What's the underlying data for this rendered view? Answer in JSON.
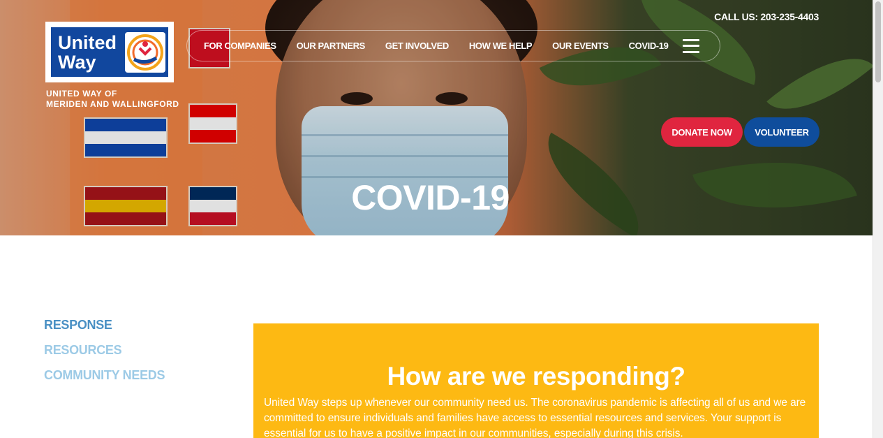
{
  "header": {
    "logo": {
      "line1": "United",
      "line2": "Way",
      "mark": "united-way-hand-logo"
    },
    "tagline": [
      "UNITED WAY OF",
      "MERIDEN AND WALLINGFORD"
    ],
    "call_us": "CALL US: 203-235-4403",
    "nav": {
      "items": [
        "FOR COMPANIES",
        "OUR PARTNERS",
        "GET INVOLVED",
        "HOW WE HELP",
        "OUR EVENTS",
        "COVID-19"
      ],
      "menu_icon": "hamburger-icon"
    },
    "buttons": {
      "donate": "DONATE NOW",
      "volunteer": "VOLUNTEER"
    }
  },
  "hero": {
    "title": "COVID-19"
  },
  "sidebar": {
    "items": [
      {
        "label": "RESPONSE",
        "active": true
      },
      {
        "label": "RESOURCES",
        "active": false
      },
      {
        "label": "COMMUNITY NEEDS",
        "active": false
      }
    ]
  },
  "panel": {
    "title": "How are we responding?",
    "body": "United Way steps up whenever our community need us. The coronavirus pandemic is affecting all of us and we are committed to ensure individuals and families have access to essential resources and services. Your support is essential for us to have a positive impact in our communities, especially during this crisis."
  },
  "colors": {
    "brand_blue": "#11479e",
    "donate_red": "#e0253f",
    "volunteer_blue": "#0f4d9c",
    "panel_yellow": "#fdb913",
    "side_active": "#4a90c4",
    "side_inactive": "#9ccae6"
  }
}
